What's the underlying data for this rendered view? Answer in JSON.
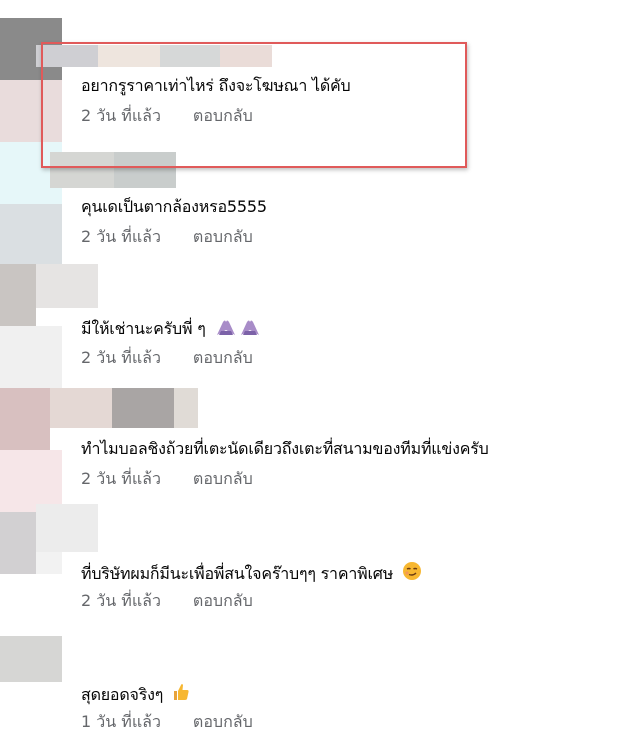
{
  "comments": [
    {
      "text": "อยากรูราคาเท่าไหร่ ถึงจะโฆษณา ได้คับ",
      "time": "2 วัน ที่แล้ว",
      "reply": "ตอบกลับ"
    },
    {
      "text": "คุนเดเป็นตากล้องหรอ5555",
      "time": "2 วัน ที่แล้ว",
      "reply": "ตอบกลับ"
    },
    {
      "text": "มีให้เช่านะครับพี่ ๆ",
      "time": "2 วัน ที่แล้ว",
      "reply": "ตอบกลับ",
      "emoji": "praying-hands-emoji"
    },
    {
      "text": "ทำไมบอลชิงถ้วยที่เตะนัดเดียวถึงเตะที่สนามของทีมที่แข่งครับ",
      "time": "2 วัน ที่แล้ว",
      "reply": "ตอบกลับ"
    },
    {
      "text": "ที่บริษัทผมก็มีนะเพื่อพี่สนใจคร๊าบๆๆ ราคาพิเศษ",
      "time": "2 วัน ที่แล้ว",
      "reply": "ตอบกลับ",
      "emoji": "smirk-face-emoji"
    },
    {
      "text": "สุดยอดจริงๆ",
      "time": "1 วัน ที่แล้ว",
      "reply": "ตอบกลับ",
      "emoji": "thumbs-up-emoji"
    }
  ],
  "colors": {
    "highlight": "#e05a5a",
    "text": "#050505",
    "meta": "#65676b"
  }
}
